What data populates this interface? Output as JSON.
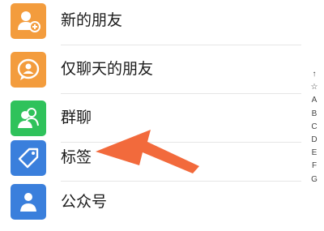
{
  "contacts": {
    "items": [
      {
        "label": "新的朋友",
        "icon": "add-friend-icon",
        "color": "#f39c3d"
      },
      {
        "label": "仅聊天的朋友",
        "icon": "chat-only-friend-icon",
        "color": "#f39c3d"
      },
      {
        "label": "群聊",
        "icon": "group-chat-icon",
        "color": "#2fc25b"
      },
      {
        "label": "标签",
        "icon": "tag-icon",
        "color": "#3a7fdc"
      },
      {
        "label": "公众号",
        "icon": "official-account-icon",
        "color": "#3a7fdc"
      }
    ]
  },
  "index_bar": [
    "↑",
    "☆",
    "A",
    "B",
    "C",
    "D",
    "E",
    "F",
    "G"
  ],
  "annotation": {
    "arrow_color": "#f26a3c",
    "points_to": "标签"
  }
}
